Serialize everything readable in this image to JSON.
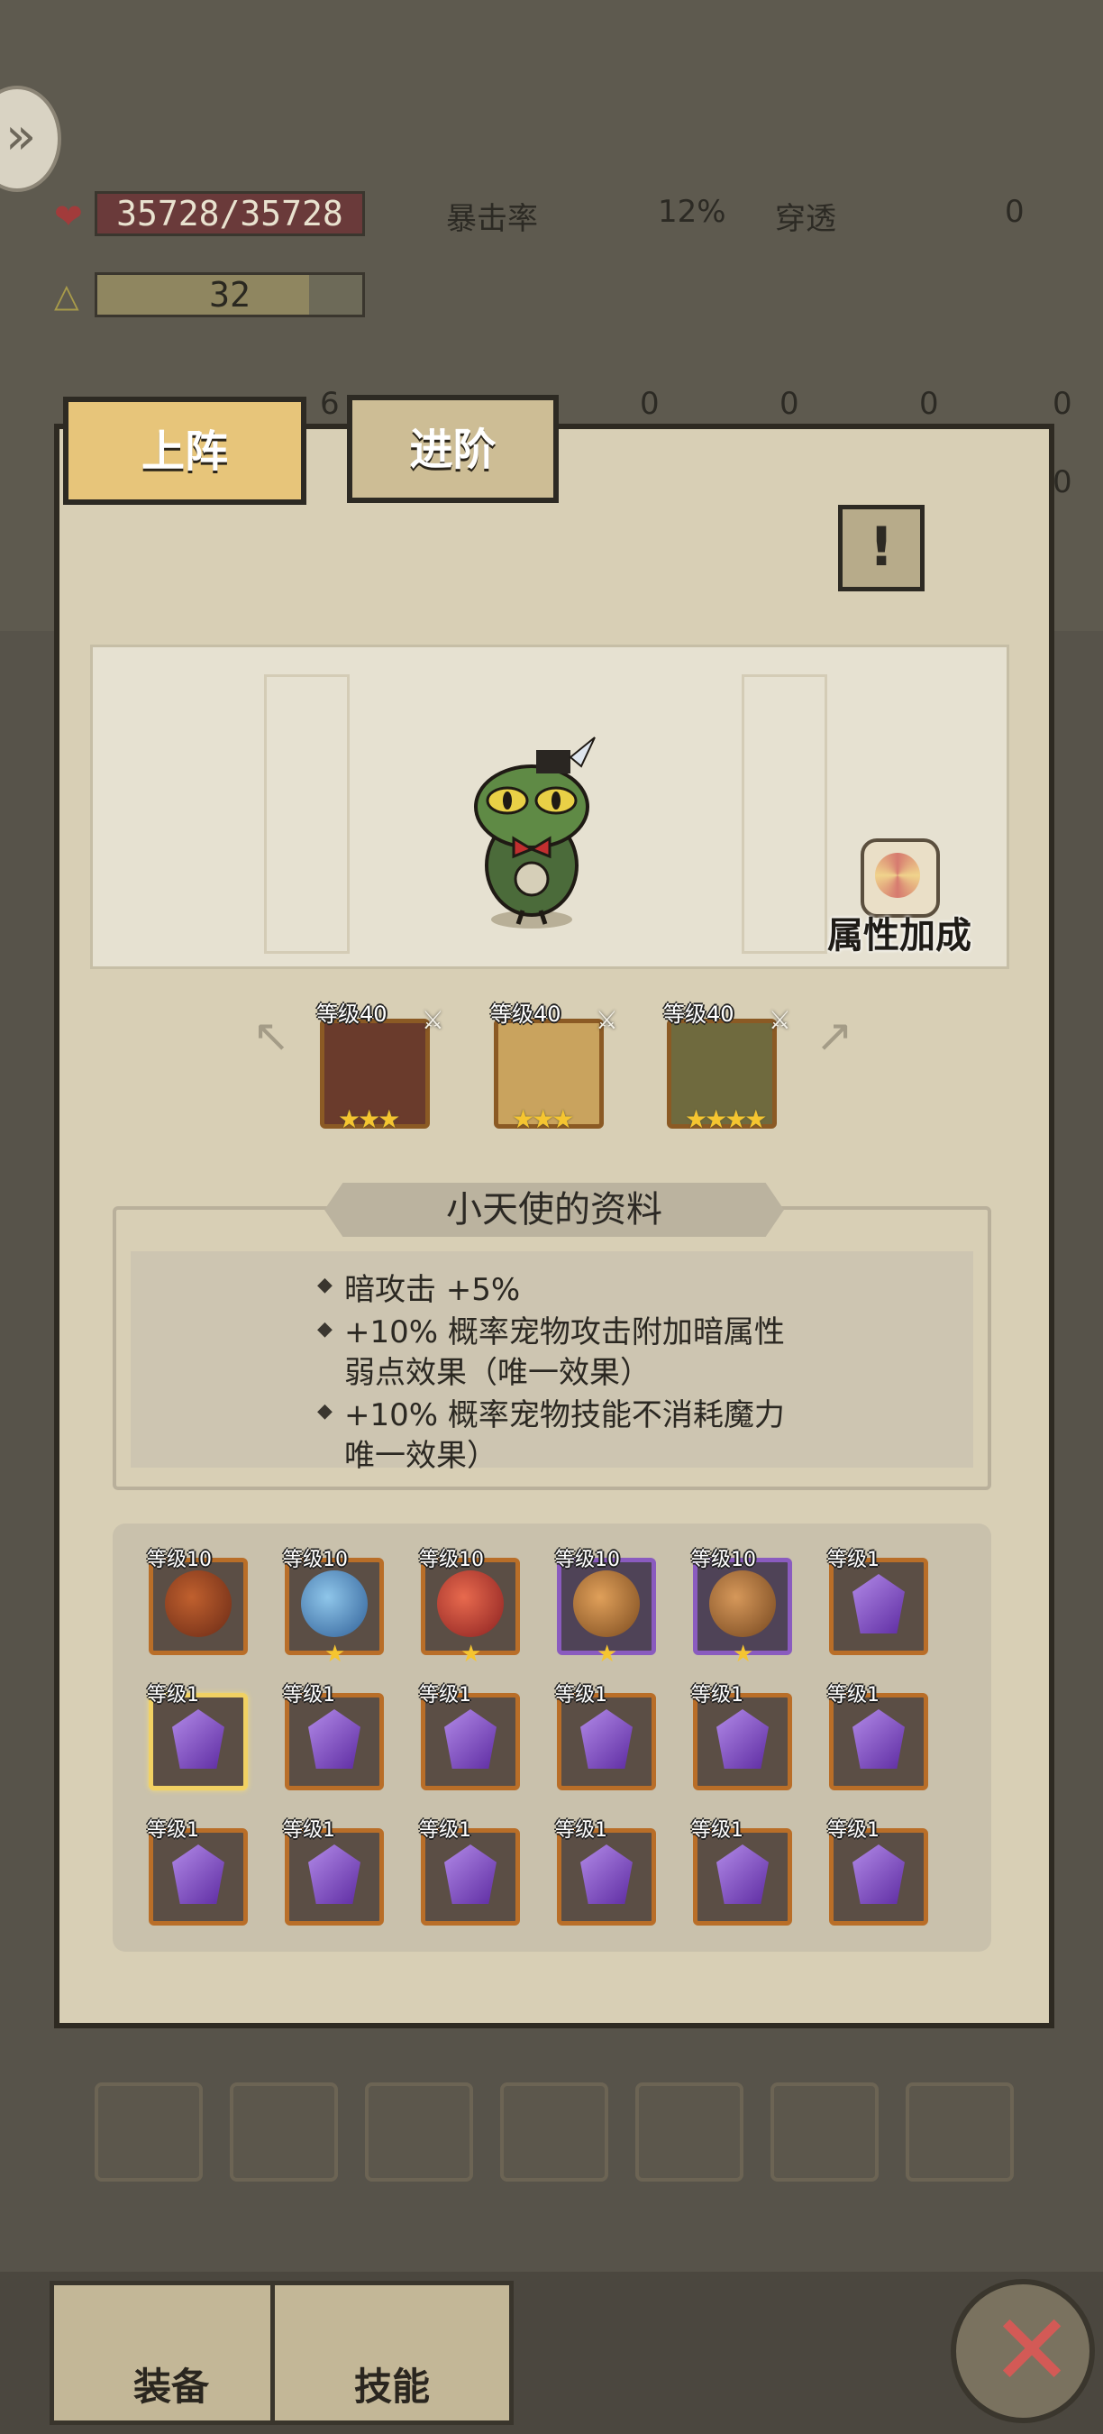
{
  "stats": {
    "hp": "35728/35728",
    "level": "32",
    "crit_label": "暴击率",
    "crit_value": "12%",
    "pierce_label": "穿透",
    "pierce_value": "0",
    "side_values": [
      "6",
      "0",
      "0",
      "0",
      "0",
      "0"
    ],
    "right_values": [
      "0",
      "0"
    ]
  },
  "tabs": {
    "deploy": "上阵",
    "advance": "进阶"
  },
  "scene": {
    "attr_bonus_label": "属性加成"
  },
  "equipment": [
    {
      "level": "等级40",
      "stars": 3
    },
    {
      "level": "等级40",
      "stars": 3
    },
    {
      "level": "等级40",
      "stars": 4
    }
  ],
  "info": {
    "title": "小天使的资料",
    "lines": [
      "暗攻击  +5%",
      " +10%  概率宠物攻击附加暗属性",
      "弱点效果（唯一效果）",
      " +10%  概率宠物技能不消耗魔力",
      "唯一效果）"
    ]
  },
  "pets": [
    {
      "level": "等级10",
      "kind": "fire-ball",
      "stars": 0
    },
    {
      "level": "等级10",
      "kind": "blue-dragon",
      "stars": 1
    },
    {
      "level": "等级10",
      "kind": "red-dragon",
      "stars": 1
    },
    {
      "level": "等级10",
      "kind": "rock-ball",
      "stars": 1
    },
    {
      "level": "等级10",
      "kind": "rock-ball",
      "stars": 1
    },
    {
      "level": "等级1",
      "kind": "gem",
      "stars": 0
    },
    {
      "level": "等级1",
      "kind": "gem",
      "stars": 0
    },
    {
      "level": "等级1",
      "kind": "gem",
      "stars": 0
    },
    {
      "level": "等级1",
      "kind": "gem",
      "stars": 0
    },
    {
      "level": "等级1",
      "kind": "gem",
      "stars": 0
    },
    {
      "level": "等级1",
      "kind": "gem",
      "stars": 0
    },
    {
      "level": "等级1",
      "kind": "gem",
      "stars": 0
    },
    {
      "level": "等级1",
      "kind": "gem",
      "stars": 0
    },
    {
      "level": "等级1",
      "kind": "gem",
      "stars": 0
    },
    {
      "level": "等级1",
      "kind": "gem",
      "stars": 0
    },
    {
      "level": "等级1",
      "kind": "gem",
      "stars": 0
    },
    {
      "level": "等级1",
      "kind": "gem",
      "stars": 0
    },
    {
      "level": "等级1",
      "kind": "gem",
      "stars": 0
    }
  ],
  "bottom_nav": {
    "equip": "装备",
    "skill": "技能"
  },
  "colors": {
    "panel": "#d8cfb5",
    "tab_active": "#e7c57a",
    "star": "#f5c530",
    "close_x": "#d35a56"
  }
}
